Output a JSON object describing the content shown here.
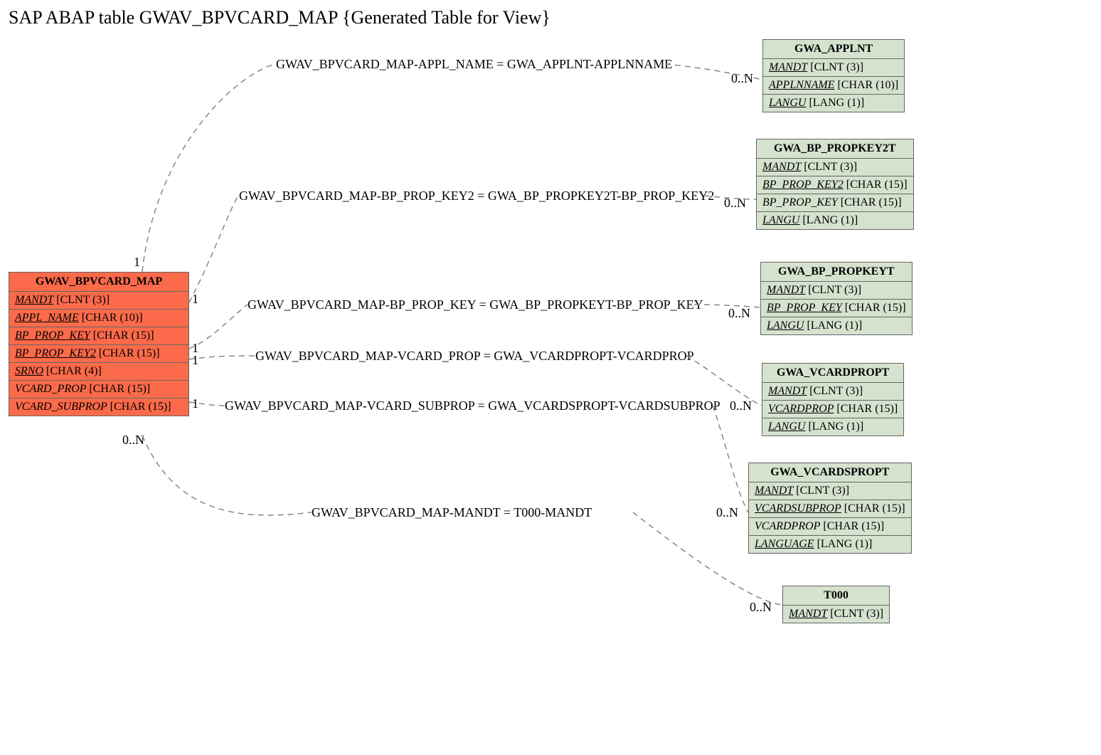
{
  "title": "SAP ABAP table GWAV_BPVCARD_MAP {Generated Table for View}",
  "colors": {
    "orange": "#fb6a4a",
    "green": "#d5e2ce"
  },
  "main_entity": {
    "name": "GWAV_BPVCARD_MAP",
    "fields": [
      {
        "name": "MANDT",
        "type": "[CLNT (3)]",
        "key": true
      },
      {
        "name": "APPL_NAME",
        "type": "[CHAR (10)]",
        "key": true
      },
      {
        "name": "BP_PROP_KEY",
        "type": "[CHAR (15)]",
        "key": true
      },
      {
        "name": "BP_PROP_KEY2",
        "type": "[CHAR (15)]",
        "key": true
      },
      {
        "name": "SRNO",
        "type": "[CHAR (4)]",
        "key": true
      },
      {
        "name": "VCARD_PROP",
        "type": "[CHAR (15)]",
        "key": false
      },
      {
        "name": "VCARD_SUBPROP",
        "type": "[CHAR (15)]",
        "key": false
      }
    ]
  },
  "related": [
    {
      "name": "GWA_APPLNT",
      "fields": [
        {
          "name": "MANDT",
          "type": "[CLNT (3)]",
          "key": true
        },
        {
          "name": "APPLNNAME",
          "type": "[CHAR (10)]",
          "key": true
        },
        {
          "name": "LANGU",
          "type": "[LANG (1)]",
          "key": true
        }
      ]
    },
    {
      "name": "GWA_BP_PROPKEY2T",
      "fields": [
        {
          "name": "MANDT",
          "type": "[CLNT (3)]",
          "key": true
        },
        {
          "name": "BP_PROP_KEY2",
          "type": "[CHAR (15)]",
          "key": true
        },
        {
          "name": "BP_PROP_KEY",
          "type": "[CHAR (15)]",
          "key": false
        },
        {
          "name": "LANGU",
          "type": "[LANG (1)]",
          "key": true
        }
      ]
    },
    {
      "name": "GWA_BP_PROPKEYT",
      "fields": [
        {
          "name": "MANDT",
          "type": "[CLNT (3)]",
          "key": true
        },
        {
          "name": "BP_PROP_KEY",
          "type": "[CHAR (15)]",
          "key": true
        },
        {
          "name": "LANGU",
          "type": "[LANG (1)]",
          "key": true
        }
      ]
    },
    {
      "name": "GWA_VCARDPROPT",
      "fields": [
        {
          "name": "MANDT",
          "type": "[CLNT (3)]",
          "key": true
        },
        {
          "name": "VCARDPROP",
          "type": "[CHAR (15)]",
          "key": true
        },
        {
          "name": "LANGU",
          "type": "[LANG (1)]",
          "key": true
        }
      ]
    },
    {
      "name": "GWA_VCARDSPROPT",
      "fields": [
        {
          "name": "MANDT",
          "type": "[CLNT (3)]",
          "key": true
        },
        {
          "name": "VCARDSUBPROP",
          "type": "[CHAR (15)]",
          "key": true
        },
        {
          "name": "VCARDPROP",
          "type": "[CHAR (15)]",
          "key": false
        },
        {
          "name": "LANGUAGE",
          "type": "[LANG (1)]",
          "key": true
        }
      ]
    },
    {
      "name": "T000",
      "fields": [
        {
          "name": "MANDT",
          "type": "[CLNT (3)]",
          "key": true
        }
      ]
    }
  ],
  "relations": [
    {
      "label": "GWAV_BPVCARD_MAP-APPL_NAME = GWA_APPLNT-APPLNNAME"
    },
    {
      "label": "GWAV_BPVCARD_MAP-BP_PROP_KEY2 = GWA_BP_PROPKEY2T-BP_PROP_KEY2"
    },
    {
      "label": "GWAV_BPVCARD_MAP-BP_PROP_KEY = GWA_BP_PROPKEYT-BP_PROP_KEY"
    },
    {
      "label": "GWAV_BPVCARD_MAP-VCARD_PROP = GWA_VCARDPROPT-VCARDPROP"
    },
    {
      "label": "GWAV_BPVCARD_MAP-VCARD_SUBPROP = GWA_VCARDSPROPT-VCARDSUBPROP"
    },
    {
      "label": "GWAV_BPVCARD_MAP-MANDT = T000-MANDT"
    }
  ],
  "cardinalities": {
    "main_side": [
      "1",
      "1",
      "1",
      "1",
      "1",
      "0..N"
    ],
    "related_side": [
      "0..N",
      "0..N",
      "0..N",
      "0..N",
      "0..N",
      "0..N"
    ]
  }
}
